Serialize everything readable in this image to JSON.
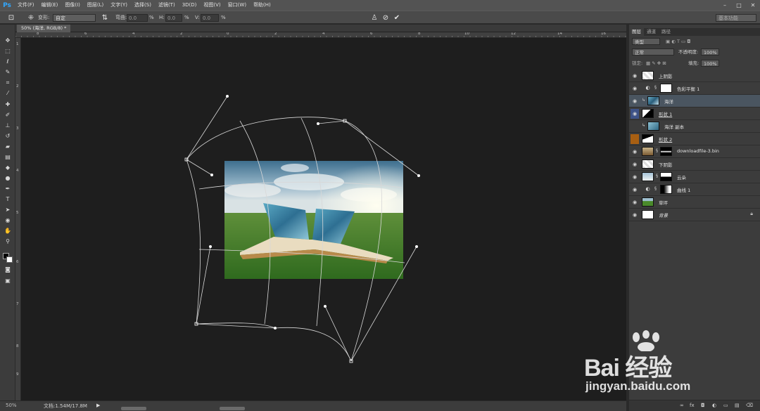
{
  "app": {
    "logo": "Ps"
  },
  "menu": [
    "文件(F)",
    "编辑(E)",
    "图像(I)",
    "图层(L)",
    "文字(Y)",
    "选择(S)",
    "滤镜(T)",
    "3D(D)",
    "视图(V)",
    "窗口(W)",
    "帮助(H)"
  ],
  "window_controls": {
    "minimize": "–",
    "maximize": "□",
    "close": "✕"
  },
  "options": {
    "warp_label": "变形:",
    "warp_value": "自定",
    "bend_label": "弯曲:",
    "bend_value": "0.0",
    "h_label": "H:",
    "h_value": "0.0",
    "v_label": "V:",
    "v_value": "0.0",
    "percent": "%",
    "workspace": "基本功能"
  },
  "tools": [
    "move-icon",
    "marquee-icon",
    "lasso-icon",
    "quick-select-icon",
    "crop-icon",
    "eyedropper-icon",
    "healing-icon",
    "brush-icon",
    "stamp-icon",
    "history-brush-icon",
    "eraser-icon",
    "gradient-icon",
    "blur-icon",
    "dodge-icon",
    "pen-icon",
    "type-icon",
    "path-select-icon",
    "shape-icon",
    "hand-icon",
    "zoom-icon"
  ],
  "document": {
    "tab": "50% (海洋, RGB/8) *"
  },
  "ruler_top": [
    "8",
    "6",
    "4",
    "2",
    "0",
    "2",
    "4",
    "6",
    "8",
    "10",
    "12",
    "14",
    "16"
  ],
  "ruler_left": [
    "1",
    "2",
    "3",
    "4",
    "5",
    "6",
    "7",
    "8",
    "9"
  ],
  "status": {
    "zoom": "50%",
    "doc": "文档:1.54M/17.8M",
    "arrow": "▶"
  },
  "panel": {
    "tabs": [
      "图层",
      "通道",
      "路径"
    ],
    "filter_label": "类型",
    "blend_mode": "正常",
    "opacity_label": "不透明度:",
    "opacity_value": "100%",
    "lock_label": "锁定:",
    "fill_label": "填充:",
    "fill_value": "100%"
  },
  "layers": [
    {
      "name": "上阴影"
    },
    {
      "name": "色彩平衡 1"
    },
    {
      "name": "海洋"
    },
    {
      "name": "形状 1"
    },
    {
      "name": "海洋 副本"
    },
    {
      "name": "形状 2"
    },
    {
      "name": "downloadfile-3.bin"
    },
    {
      "name": "下阴影"
    },
    {
      "name": "云朵"
    },
    {
      "name": "曲线 1"
    },
    {
      "name": "草坪"
    },
    {
      "name": "背景"
    }
  ],
  "watermark": {
    "text": "Bai 经验",
    "sub": "jingyan.baidu.com"
  },
  "colors": {
    "canvas": "#1e1e1e",
    "panel": "#3c3c3c",
    "selected_layer": "#4a5560",
    "accent_blue": "#3d5287",
    "accent_orange": "#a85f12"
  }
}
